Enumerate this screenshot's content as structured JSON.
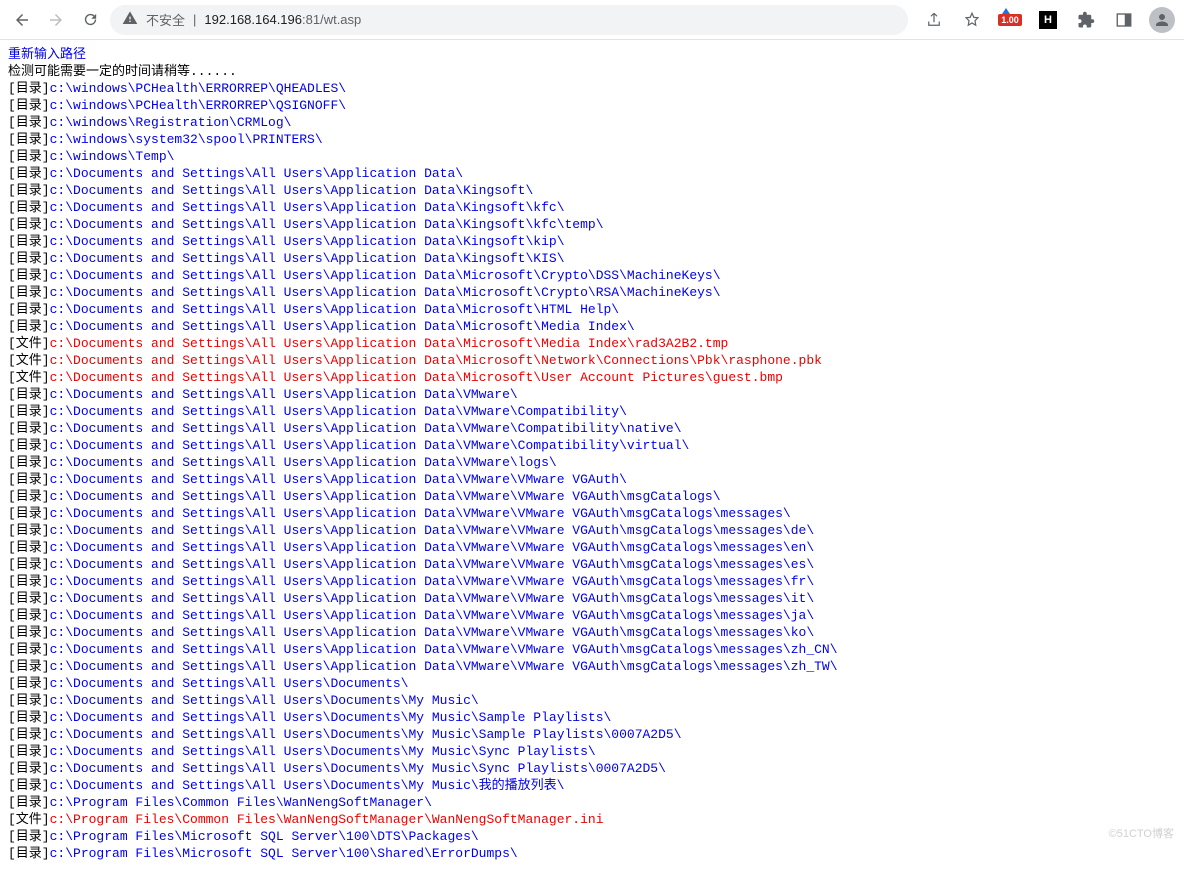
{
  "browser": {
    "insecure_label": "不安全",
    "url_host": "192.168.164.196",
    "url_port_path": ":81/wt.asp",
    "badge_text": "1.00",
    "h_label": "H"
  },
  "page": {
    "reinput_link": "重新输入路径",
    "wait_text": "检测可能需要一定的时间请稍等......",
    "label_dir": "[目录]",
    "label_file": "[文件]",
    "watermark": "©51CTO博客"
  },
  "entries": [
    {
      "t": "dir",
      "p": "c:\\windows\\PCHealth\\ERRORREP\\QHEADLES\\"
    },
    {
      "t": "dir",
      "p": "c:\\windows\\PCHealth\\ERRORREP\\QSIGNOFF\\"
    },
    {
      "t": "dir",
      "p": "c:\\windows\\Registration\\CRMLog\\"
    },
    {
      "t": "dir",
      "p": "c:\\windows\\system32\\spool\\PRINTERS\\"
    },
    {
      "t": "dir",
      "p": "c:\\windows\\Temp\\"
    },
    {
      "t": "dir",
      "p": "c:\\Documents and Settings\\All Users\\Application Data\\"
    },
    {
      "t": "dir",
      "p": "c:\\Documents and Settings\\All Users\\Application Data\\Kingsoft\\"
    },
    {
      "t": "dir",
      "p": "c:\\Documents and Settings\\All Users\\Application Data\\Kingsoft\\kfc\\"
    },
    {
      "t": "dir",
      "p": "c:\\Documents and Settings\\All Users\\Application Data\\Kingsoft\\kfc\\temp\\"
    },
    {
      "t": "dir",
      "p": "c:\\Documents and Settings\\All Users\\Application Data\\Kingsoft\\kip\\"
    },
    {
      "t": "dir",
      "p": "c:\\Documents and Settings\\All Users\\Application Data\\Kingsoft\\KIS\\"
    },
    {
      "t": "dir",
      "p": "c:\\Documents and Settings\\All Users\\Application Data\\Microsoft\\Crypto\\DSS\\MachineKeys\\"
    },
    {
      "t": "dir",
      "p": "c:\\Documents and Settings\\All Users\\Application Data\\Microsoft\\Crypto\\RSA\\MachineKeys\\"
    },
    {
      "t": "dir",
      "p": "c:\\Documents and Settings\\All Users\\Application Data\\Microsoft\\HTML Help\\"
    },
    {
      "t": "dir",
      "p": "c:\\Documents and Settings\\All Users\\Application Data\\Microsoft\\Media Index\\"
    },
    {
      "t": "file",
      "p": "c:\\Documents and Settings\\All Users\\Application Data\\Microsoft\\Media Index\\rad3A2B2.tmp"
    },
    {
      "t": "file",
      "p": "c:\\Documents and Settings\\All Users\\Application Data\\Microsoft\\Network\\Connections\\Pbk\\rasphone.pbk"
    },
    {
      "t": "file",
      "p": "c:\\Documents and Settings\\All Users\\Application Data\\Microsoft\\User Account Pictures\\guest.bmp"
    },
    {
      "t": "dir",
      "p": "c:\\Documents and Settings\\All Users\\Application Data\\VMware\\"
    },
    {
      "t": "dir",
      "p": "c:\\Documents and Settings\\All Users\\Application Data\\VMware\\Compatibility\\"
    },
    {
      "t": "dir",
      "p": "c:\\Documents and Settings\\All Users\\Application Data\\VMware\\Compatibility\\native\\"
    },
    {
      "t": "dir",
      "p": "c:\\Documents and Settings\\All Users\\Application Data\\VMware\\Compatibility\\virtual\\"
    },
    {
      "t": "dir",
      "p": "c:\\Documents and Settings\\All Users\\Application Data\\VMware\\logs\\"
    },
    {
      "t": "dir",
      "p": "c:\\Documents and Settings\\All Users\\Application Data\\VMware\\VMware VGAuth\\"
    },
    {
      "t": "dir",
      "p": "c:\\Documents and Settings\\All Users\\Application Data\\VMware\\VMware VGAuth\\msgCatalogs\\"
    },
    {
      "t": "dir",
      "p": "c:\\Documents and Settings\\All Users\\Application Data\\VMware\\VMware VGAuth\\msgCatalogs\\messages\\"
    },
    {
      "t": "dir",
      "p": "c:\\Documents and Settings\\All Users\\Application Data\\VMware\\VMware VGAuth\\msgCatalogs\\messages\\de\\"
    },
    {
      "t": "dir",
      "p": "c:\\Documents and Settings\\All Users\\Application Data\\VMware\\VMware VGAuth\\msgCatalogs\\messages\\en\\"
    },
    {
      "t": "dir",
      "p": "c:\\Documents and Settings\\All Users\\Application Data\\VMware\\VMware VGAuth\\msgCatalogs\\messages\\es\\"
    },
    {
      "t": "dir",
      "p": "c:\\Documents and Settings\\All Users\\Application Data\\VMware\\VMware VGAuth\\msgCatalogs\\messages\\fr\\"
    },
    {
      "t": "dir",
      "p": "c:\\Documents and Settings\\All Users\\Application Data\\VMware\\VMware VGAuth\\msgCatalogs\\messages\\it\\"
    },
    {
      "t": "dir",
      "p": "c:\\Documents and Settings\\All Users\\Application Data\\VMware\\VMware VGAuth\\msgCatalogs\\messages\\ja\\"
    },
    {
      "t": "dir",
      "p": "c:\\Documents and Settings\\All Users\\Application Data\\VMware\\VMware VGAuth\\msgCatalogs\\messages\\ko\\"
    },
    {
      "t": "dir",
      "p": "c:\\Documents and Settings\\All Users\\Application Data\\VMware\\VMware VGAuth\\msgCatalogs\\messages\\zh_CN\\"
    },
    {
      "t": "dir",
      "p": "c:\\Documents and Settings\\All Users\\Application Data\\VMware\\VMware VGAuth\\msgCatalogs\\messages\\zh_TW\\"
    },
    {
      "t": "dir",
      "p": "c:\\Documents and Settings\\All Users\\Documents\\"
    },
    {
      "t": "dir",
      "p": "c:\\Documents and Settings\\All Users\\Documents\\My Music\\"
    },
    {
      "t": "dir",
      "p": "c:\\Documents and Settings\\All Users\\Documents\\My Music\\Sample Playlists\\"
    },
    {
      "t": "dir",
      "p": "c:\\Documents and Settings\\All Users\\Documents\\My Music\\Sample Playlists\\0007A2D5\\"
    },
    {
      "t": "dir",
      "p": "c:\\Documents and Settings\\All Users\\Documents\\My Music\\Sync Playlists\\"
    },
    {
      "t": "dir",
      "p": "c:\\Documents and Settings\\All Users\\Documents\\My Music\\Sync Playlists\\0007A2D5\\"
    },
    {
      "t": "dir",
      "p": "c:\\Documents and Settings\\All Users\\Documents\\My Music\\我的播放列表\\"
    },
    {
      "t": "dir",
      "p": "c:\\Program Files\\Common Files\\WanNengSoftManager\\"
    },
    {
      "t": "file",
      "p": "c:\\Program Files\\Common Files\\WanNengSoftManager\\WanNengSoftManager.ini"
    },
    {
      "t": "dir",
      "p": "c:\\Program Files\\Microsoft SQL Server\\100\\DTS\\Packages\\"
    },
    {
      "t": "dir",
      "p": "c:\\Program Files\\Microsoft SQL Server\\100\\Shared\\ErrorDumps\\"
    }
  ]
}
